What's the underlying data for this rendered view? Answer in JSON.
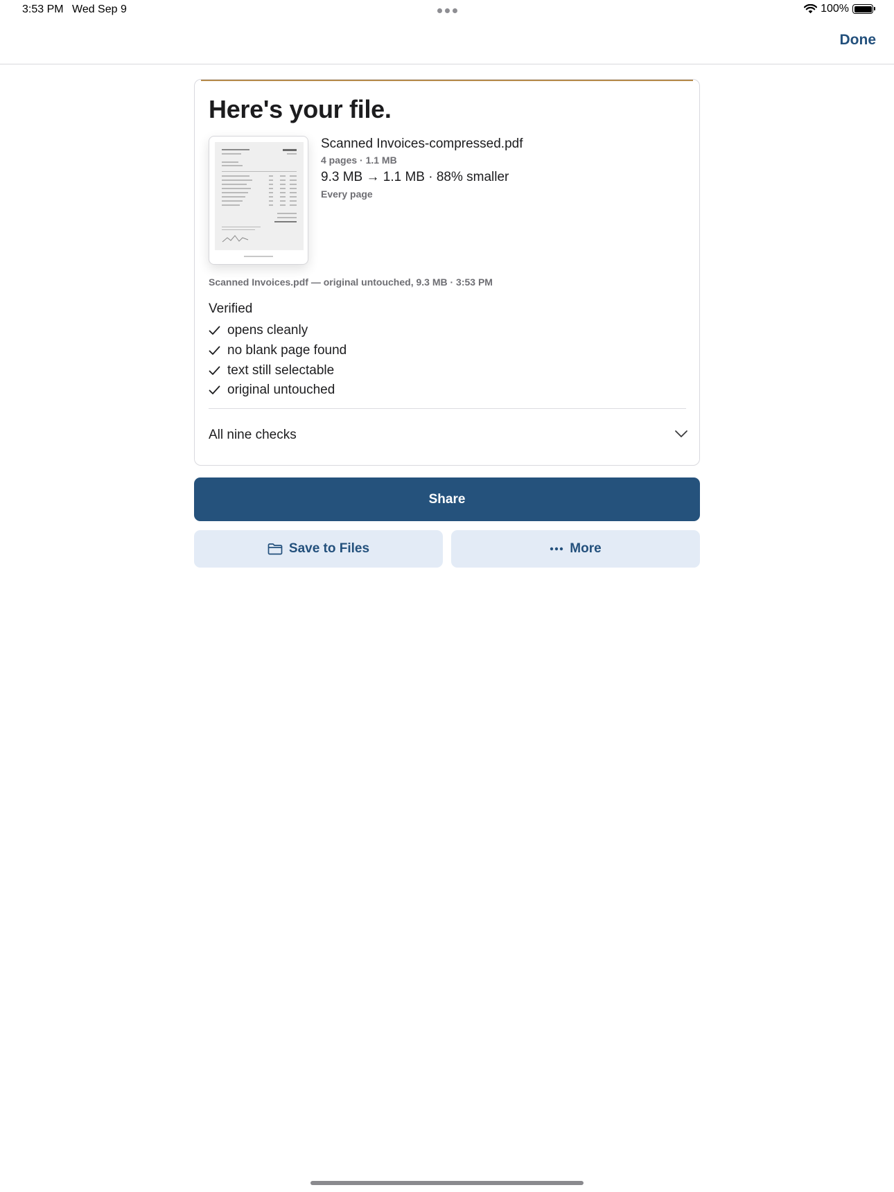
{
  "status_bar": {
    "time": "3:53 PM",
    "date": "Wed Sep 9",
    "battery": "100%"
  },
  "nav": {
    "done_label": "Done"
  },
  "card": {
    "accent_color": "#b58a4a",
    "title": "Here's your file.",
    "file_name": "Scanned Invoices-compressed.pdf",
    "file_meta": "4 pages · 1.1 MB",
    "size_change": "9.3 MB → 1.1 MB · 88% smaller",
    "scope": "Every page",
    "original_note": "Scanned Invoices.pdf — original untouched, 9.3 MB · 3:53 PM",
    "verified_heading": "Verified",
    "checks": [
      {
        "label": "opens cleanly",
        "icon": "checkmark-icon"
      },
      {
        "label": "no blank page found",
        "icon": "checkmark-icon"
      },
      {
        "label": "text still selectable",
        "icon": "checkmark-icon"
      },
      {
        "label": "original untouched",
        "icon": "checkmark-icon"
      }
    ],
    "all_checks_label": "All nine checks"
  },
  "actions": {
    "share_label": "Share",
    "save_label": "Save to Files",
    "save_icon": "folder-icon",
    "more_label": "More",
    "more_icon": "ellipsis-icon",
    "primary_color": "#25527c",
    "secondary_bg": "#e3ebf6"
  }
}
